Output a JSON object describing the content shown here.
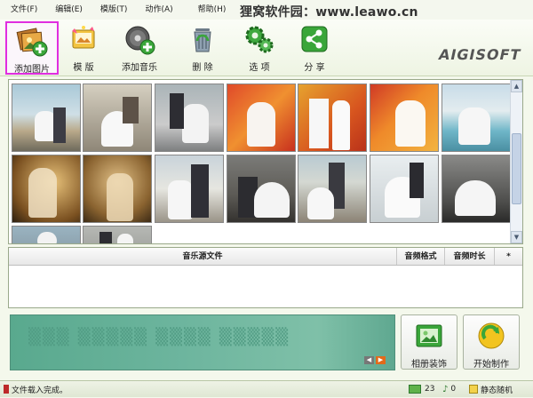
{
  "menu": [
    "文件(F)",
    "编辑(E)",
    "模版(T)",
    "动作(A)",
    "帮助(H)"
  ],
  "watermark": "狸窝软件园：www.leawo.cn",
  "toolbar": {
    "add_photo": "添加图片",
    "template": "模 版",
    "add_music": "添加音乐",
    "delete": "删 除",
    "options": "选 项",
    "share": "分 享"
  },
  "brand": "AIGISOFT",
  "gallery": {
    "thumbnail_count": 16
  },
  "music_table": {
    "columns": [
      "音乐源文件",
      "音频格式",
      "音频时长",
      "*"
    ],
    "rows": []
  },
  "actions": {
    "album_decor": "相册装饰",
    "start_make": "开始制作"
  },
  "status": {
    "message": "文件载入完成。",
    "photo_count": "23",
    "music_count": "0",
    "mode": "静态随机"
  },
  "colors": {
    "active_border": "#e02de0",
    "banner": "#6db59e",
    "accent_green": "#3aa63a"
  }
}
